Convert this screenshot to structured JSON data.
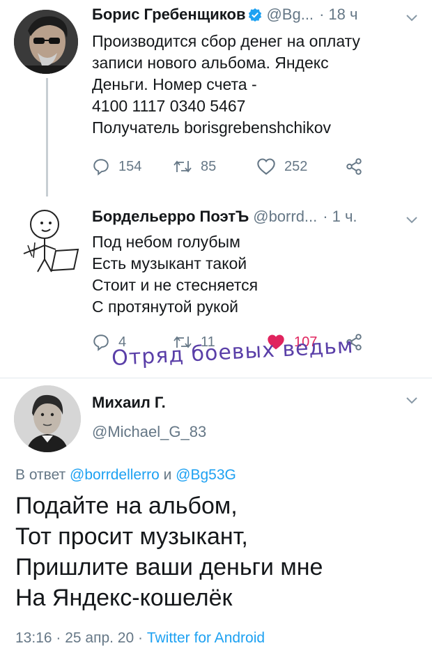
{
  "colors": {
    "accent": "#1da1f2",
    "muted": "#657786",
    "like": "#e0245e",
    "stamp": "#5a3fa8"
  },
  "tweet1": {
    "name": "Борис Гребенщиков",
    "handle": "@Bg...",
    "dot": "·",
    "time": "18 ч",
    "lines": [
      "Производится сбор денег на оплату",
      "записи нового альбома. Яндекс",
      "Деньги. Номер счета -",
      "4100 1117 0340 5467",
      "Получатель borisgrebenshchikov"
    ],
    "replies": "154",
    "retweets": "85",
    "likes": "252"
  },
  "tweet2": {
    "name": "Бордельерро ПоэтЪ",
    "handle": "@borrd...",
    "dot": "·",
    "time": "1 ч.",
    "lines": [
      "Под небом голубым",
      "Есть музыкант такой",
      "Стоит и не стесняется",
      "С протянутой рукой"
    ],
    "replies": "4",
    "retweets": "11",
    "likes": "107",
    "watermark": "Отряд боевых ведьм"
  },
  "tweet3": {
    "name": "Михаил Г.",
    "handle": "@Michael_G_83",
    "reply_prefix": "В ответ ",
    "reply_user1": "@borrdellerro",
    "reply_and": " и ",
    "reply_user2": "@Bg53G",
    "lines": [
      "Подайте на альбом,",
      "Тот просит музыкант,",
      "Пришлите ваши деньги мне",
      "На Яндекс-кошелёк"
    ],
    "date": "13:16 · 25 апр. 20 · ",
    "source": "Twitter for Android"
  }
}
